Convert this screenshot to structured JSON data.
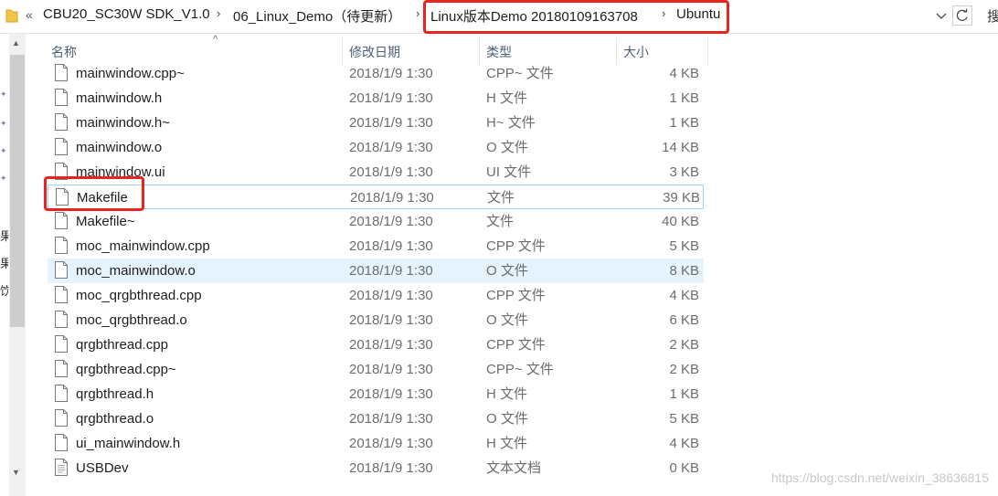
{
  "address_bar": {
    "overflow_glyph": "«",
    "crumbs": [
      "CBU20_SC30W SDK_V1.0",
      "06_Linux_Demo（待更新）",
      "Linux版本Demo 20180109163708",
      "Ubuntu"
    ],
    "separator": "›",
    "search_clip": "搜"
  },
  "columns": {
    "name": "名称",
    "date": "修改日期",
    "type": "类型",
    "size": "大小",
    "sort_glyph": "^"
  },
  "files": [
    {
      "name": "mainwindow.cpp~",
      "date": "2018/1/9 1:30",
      "type": "CPP~ 文件",
      "size": "4 KB"
    },
    {
      "name": "mainwindow.h",
      "date": "2018/1/9 1:30",
      "type": "H 文件",
      "size": "1 KB"
    },
    {
      "name": "mainwindow.h~",
      "date": "2018/1/9 1:30",
      "type": "H~ 文件",
      "size": "1 KB"
    },
    {
      "name": "mainwindow.o",
      "date": "2018/1/9 1:30",
      "type": "O 文件",
      "size": "14 KB"
    },
    {
      "name": "mainwindow.ui",
      "date": "2018/1/9 1:30",
      "type": "UI 文件",
      "size": "3 KB"
    },
    {
      "name": "Makefile",
      "date": "2018/1/9 1:30",
      "type": "文件",
      "size": "39 KB"
    },
    {
      "name": "Makefile~",
      "date": "2018/1/9 1:30",
      "type": "文件",
      "size": "40 KB"
    },
    {
      "name": "moc_mainwindow.cpp",
      "date": "2018/1/9 1:30",
      "type": "CPP 文件",
      "size": "5 KB"
    },
    {
      "name": "moc_mainwindow.o",
      "date": "2018/1/9 1:30",
      "type": "O 文件",
      "size": "8 KB"
    },
    {
      "name": "moc_qrgbthread.cpp",
      "date": "2018/1/9 1:30",
      "type": "CPP 文件",
      "size": "4 KB"
    },
    {
      "name": "moc_qrgbthread.o",
      "date": "2018/1/9 1:30",
      "type": "O 文件",
      "size": "6 KB"
    },
    {
      "name": "qrgbthread.cpp",
      "date": "2018/1/9 1:30",
      "type": "CPP 文件",
      "size": "2 KB"
    },
    {
      "name": "qrgbthread.cpp~",
      "date": "2018/1/9 1:30",
      "type": "CPP~ 文件",
      "size": "2 KB"
    },
    {
      "name": "qrgbthread.h",
      "date": "2018/1/9 1:30",
      "type": "H 文件",
      "size": "1 KB"
    },
    {
      "name": "qrgbthread.o",
      "date": "2018/1/9 1:30",
      "type": "O 文件",
      "size": "5 KB"
    },
    {
      "name": "ui_mainwindow.h",
      "date": "2018/1/9 1:30",
      "type": "H 文件",
      "size": "4 KB"
    },
    {
      "name": "USBDev",
      "date": "2018/1/9 1:30",
      "type": "文本文档",
      "size": "0 KB"
    }
  ],
  "nav_clipped_text": [
    "果",
    "果",
    "饮"
  ],
  "watermark": "https://blog.csdn.net/weixin_38636815",
  "colors": {
    "highlight_box": "#e8241f",
    "selected_row": "#e5f3ff",
    "hover_border": "#99d1ff",
    "header_text": "#4c607a"
  }
}
